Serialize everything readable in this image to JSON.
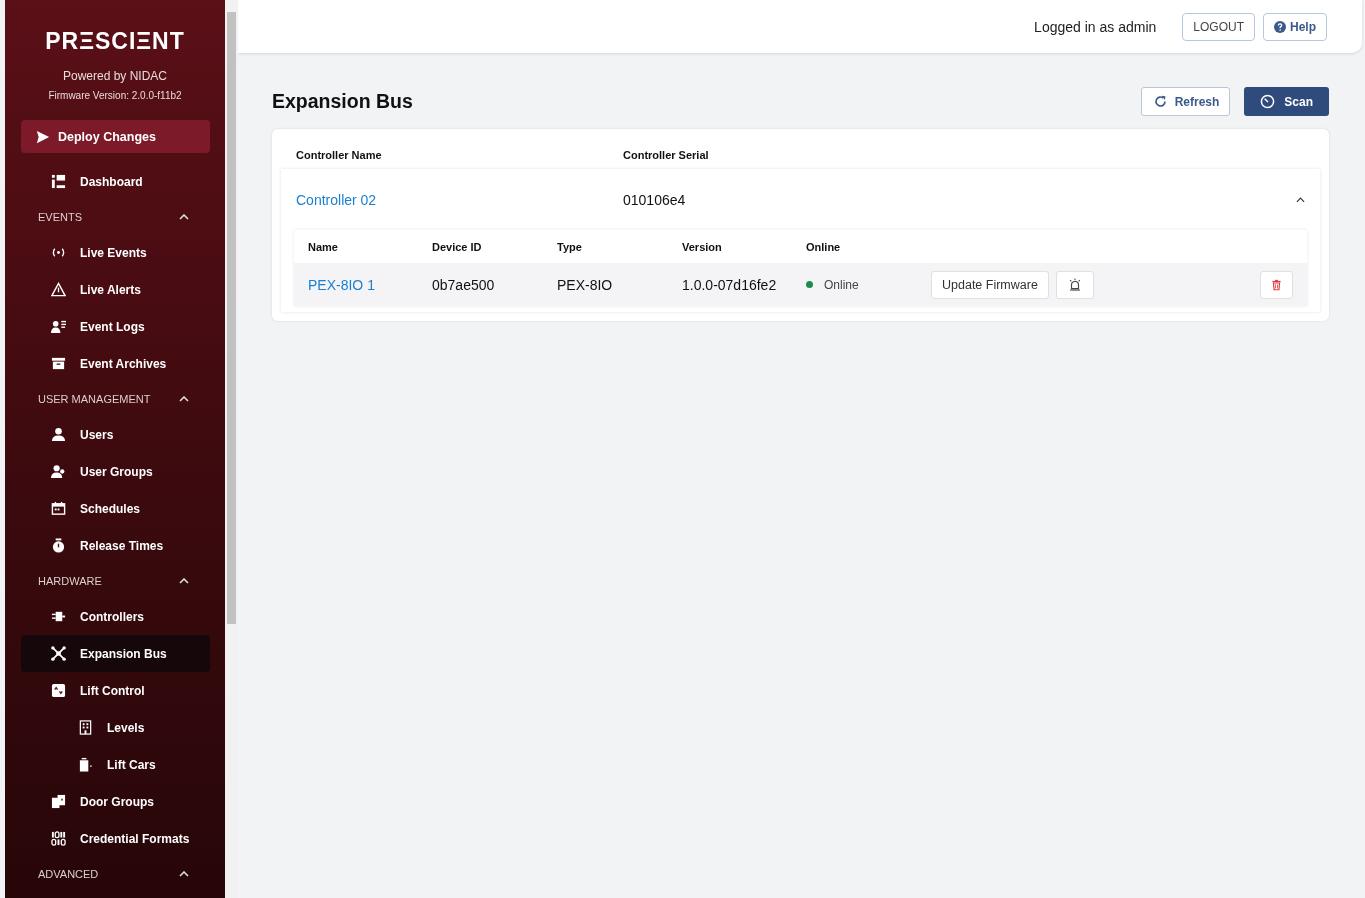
{
  "brand": {
    "logo": "PRΞSCIΞNT",
    "powered_by": "Powered by NIDAC",
    "firmware": "Firmware Version: 2.0.0-f11b2"
  },
  "deploy_button": "Deploy Changes",
  "nav": [
    {
      "kind": "item",
      "label": "Dashboard",
      "selected": false
    },
    {
      "kind": "section",
      "label": "EVENTS",
      "expanded": true
    },
    {
      "kind": "item",
      "label": "Live Events",
      "selected": false
    },
    {
      "kind": "item",
      "label": "Live Alerts",
      "selected": false
    },
    {
      "kind": "item",
      "label": "Event Logs",
      "selected": false
    },
    {
      "kind": "item",
      "label": "Event Archives",
      "selected": false
    },
    {
      "kind": "section",
      "label": "USER MANAGEMENT",
      "expanded": true
    },
    {
      "kind": "item",
      "label": "Users",
      "selected": false
    },
    {
      "kind": "item",
      "label": "User Groups",
      "selected": false
    },
    {
      "kind": "item",
      "label": "Schedules",
      "selected": false
    },
    {
      "kind": "item",
      "label": "Release Times",
      "selected": false
    },
    {
      "kind": "section",
      "label": "HARDWARE",
      "expanded": true
    },
    {
      "kind": "item",
      "label": "Controllers",
      "selected": false
    },
    {
      "kind": "item",
      "label": "Expansion Bus",
      "selected": true
    },
    {
      "kind": "item",
      "label": "Lift Control",
      "selected": false
    },
    {
      "kind": "subitem",
      "label": "Levels",
      "selected": false
    },
    {
      "kind": "subitem",
      "label": "Lift Cars",
      "selected": false
    },
    {
      "kind": "item",
      "label": "Door Groups",
      "selected": false
    },
    {
      "kind": "item",
      "label": "Credential Formats",
      "selected": false
    },
    {
      "kind": "section",
      "label": "ADVANCED",
      "expanded": true
    }
  ],
  "header": {
    "user_text": "Logged in as admin",
    "logout": "LOGOUT",
    "help": "Help"
  },
  "page": {
    "title": "Expansion Bus",
    "refresh": "Refresh",
    "scan": "Scan"
  },
  "controllers": {
    "columns": [
      "Controller Name",
      "Controller Serial"
    ],
    "rows": [
      {
        "name": "Controller 02",
        "serial": "010106e4",
        "expanded": true,
        "devices": {
          "columns": [
            "Name",
            "Device ID",
            "Type",
            "Version",
            "Online"
          ],
          "rows": [
            {
              "name": "PEX-8IO 1",
              "device_id": "0b7ae500",
              "type": "PEX-8IO",
              "version": "1.0.0-07d16fe2",
              "status": "Online",
              "color": "#1e8a4c",
              "update_button": "Update Firmware"
            }
          ]
        }
      }
    ]
  }
}
